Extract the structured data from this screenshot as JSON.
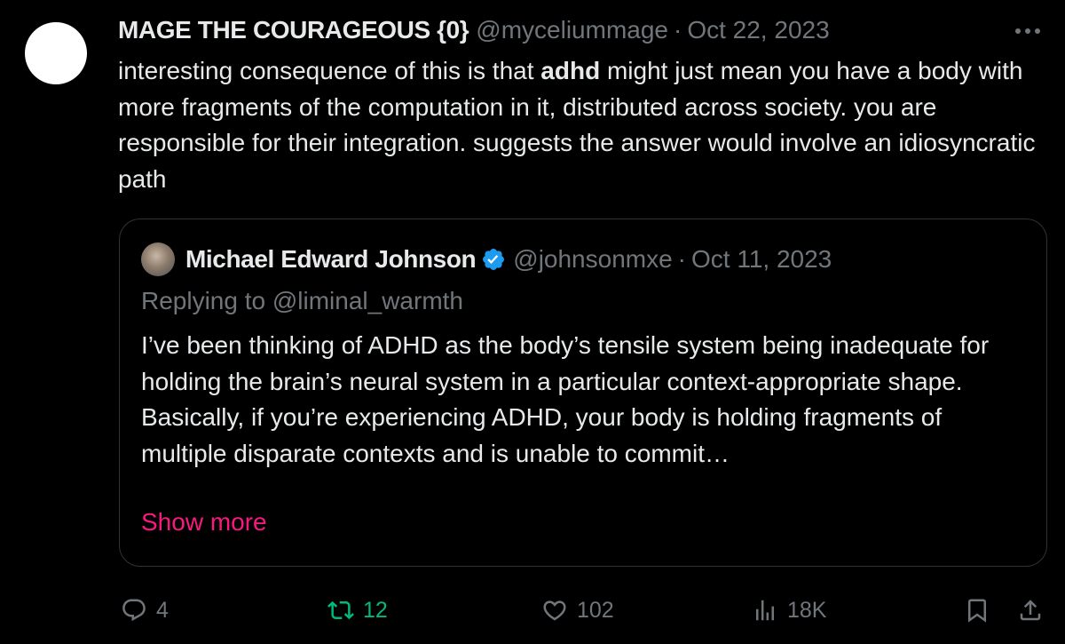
{
  "tweet": {
    "author_name": "MAGE THE COURAGEOUS {0}",
    "handle": "@myceliummage",
    "separator": "·",
    "date": "Oct 22, 2023",
    "body_pre": "interesting consequence of this is that ",
    "body_bold": "adhd",
    "body_post": " might just mean you have a body with more fragments of the computation in it, distributed across society. you are responsible for their integration. suggests the answer would involve an idiosyncratic path"
  },
  "quote": {
    "author_name": "Michael Edward Johnson",
    "handle": "@johnsonmxe",
    "separator": "·",
    "date": "Oct 11, 2023",
    "replying_to": "Replying to @liminal_warmth",
    "text": "I’ve been thinking of ADHD as the body’s tensile system being inadequate for holding the brain’s neural system in a particular context-appropriate shape. Basically, if you’re experiencing ADHD, your body is holding fragments of multiple disparate contexts and is unable to commit…",
    "show_more": "Show more"
  },
  "actions": {
    "replies": "4",
    "reposts": "12",
    "likes": "102",
    "views": "18K"
  },
  "icons": {
    "more": "more-dots-icon",
    "verified": "verified-badge-icon",
    "reply": "reply-bubble-icon",
    "repost": "repost-arrows-icon",
    "like": "heart-icon",
    "views": "bar-chart-icon",
    "bookmark": "bookmark-icon",
    "share": "share-upload-icon"
  },
  "colors": {
    "background": "#000000",
    "text": "#e7e9ea",
    "muted": "#71767b",
    "border": "#2f3336",
    "link_pink": "#f91880",
    "repost_green": "#00ba7c",
    "verified_blue": "#1d9bf0"
  }
}
